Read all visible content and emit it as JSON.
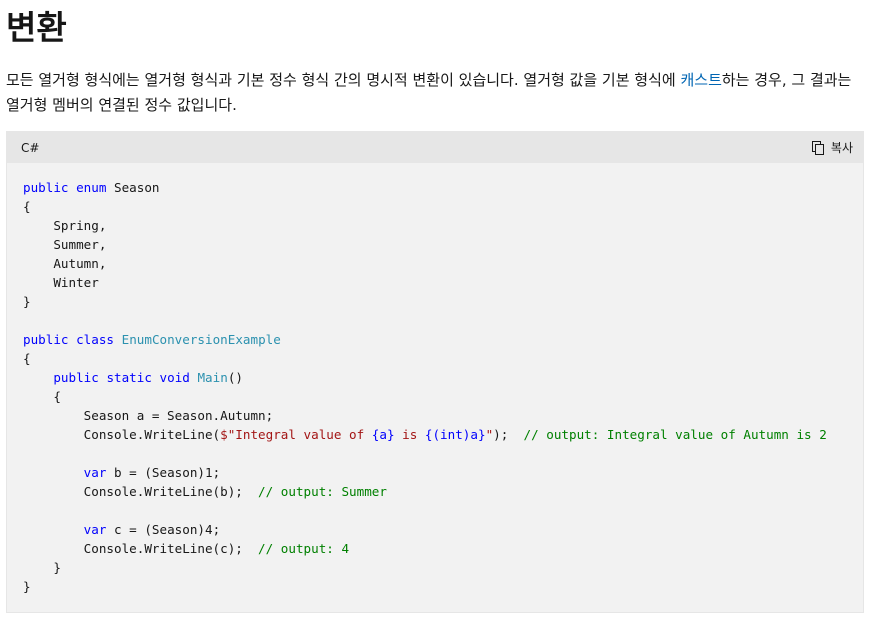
{
  "heading": "변환",
  "intro": {
    "before_link": "모든 열거형 형식에는 열거형 형식과 기본 정수 형식 간의 명시적 변환이 있습니다. 열거형 값을 기본 형식에 ",
    "link_text": "캐스트",
    "after_link": "하는 경우, 그 결과는 열거형 멤버의 연결된 정수 값입니다."
  },
  "code_block": {
    "language": "C#",
    "copy_label": "복사",
    "copy_icon": "copy-icon",
    "lines": [
      [
        {
          "t": "public",
          "c": "k"
        },
        {
          "t": " "
        },
        {
          "t": "enum",
          "c": "k"
        },
        {
          "t": " Season"
        }
      ],
      [
        {
          "t": "{"
        }
      ],
      [
        {
          "t": "    Spring,"
        }
      ],
      [
        {
          "t": "    Summer,"
        }
      ],
      [
        {
          "t": "    Autumn,"
        }
      ],
      [
        {
          "t": "    Winter"
        }
      ],
      [
        {
          "t": "}"
        }
      ],
      [],
      [
        {
          "t": "public",
          "c": "k"
        },
        {
          "t": " "
        },
        {
          "t": "class",
          "c": "k"
        },
        {
          "t": " "
        },
        {
          "t": "EnumConversionExample",
          "c": "t"
        }
      ],
      [
        {
          "t": "{"
        }
      ],
      [
        {
          "t": "    "
        },
        {
          "t": "public",
          "c": "k"
        },
        {
          "t": " "
        },
        {
          "t": "static",
          "c": "k"
        },
        {
          "t": " "
        },
        {
          "t": "void",
          "c": "k"
        },
        {
          "t": " "
        },
        {
          "t": "Main",
          "c": "t"
        },
        {
          "t": "()"
        }
      ],
      [
        {
          "t": "    {"
        }
      ],
      [
        {
          "t": "        Season a = Season.Autumn;"
        }
      ],
      [
        {
          "t": "        Console.WriteLine("
        },
        {
          "t": "$\"Integral value of ",
          "c": "s"
        },
        {
          "t": "{a}",
          "c": "k"
        },
        {
          "t": " is ",
          "c": "s"
        },
        {
          "t": "{(int)a}",
          "c": "k"
        },
        {
          "t": "\"",
          "c": "s"
        },
        {
          "t": ");  "
        },
        {
          "t": "// output: Integral value of Autumn is 2",
          "c": "c"
        }
      ],
      [],
      [
        {
          "t": "        "
        },
        {
          "t": "var",
          "c": "k"
        },
        {
          "t": " b = (Season)1;"
        }
      ],
      [
        {
          "t": "        Console.WriteLine(b);  "
        },
        {
          "t": "// output: Summer",
          "c": "c"
        }
      ],
      [],
      [
        {
          "t": "        "
        },
        {
          "t": "var",
          "c": "k"
        },
        {
          "t": " c = (Season)4;"
        }
      ],
      [
        {
          "t": "        Console.WriteLine(c);  "
        },
        {
          "t": "// output: 4",
          "c": "c"
        }
      ],
      [
        {
          "t": "    }"
        }
      ],
      [
        {
          "t": "}"
        }
      ]
    ]
  }
}
